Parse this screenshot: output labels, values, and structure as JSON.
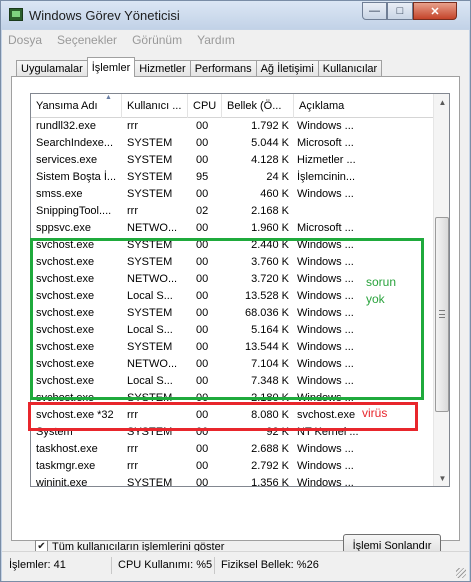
{
  "window": {
    "title": "Windows Görev Yöneticisi",
    "controls": {
      "minimize": "—",
      "maximize": "□",
      "close": "✕"
    }
  },
  "menu": [
    "Dosya",
    "Seçenekler",
    "Görünüm",
    "Yardım"
  ],
  "tabs": [
    "Uygulamalar",
    "İşlemler",
    "Hizmetler",
    "Performans",
    "Ağ İletişimi",
    "Kullanıcılar"
  ],
  "active_tab": "İşlemler",
  "table": {
    "columns": [
      "Yansıma Adı",
      "Kullanıcı ...",
      "CPU",
      "Bellek (Ö...",
      "Açıklama"
    ],
    "rows": [
      [
        "rundll32.exe",
        "rrr",
        "00",
        "1.792 K",
        "Windows ..."
      ],
      [
        "SearchIndexe...",
        "SYSTEM",
        "00",
        "5.044 K",
        "Microsoft ..."
      ],
      [
        "services.exe",
        "SYSTEM",
        "00",
        "4.128 K",
        "Hizmetler ..."
      ],
      [
        "Sistem Boşta İ...",
        "SYSTEM",
        "95",
        "24 K",
        "İşlemcinin..."
      ],
      [
        "smss.exe",
        "SYSTEM",
        "00",
        "460 K",
        "Windows ..."
      ],
      [
        "SnippingTool....",
        "rrr",
        "02",
        "2.168 K",
        ""
      ],
      [
        "sppsvc.exe",
        "NETWO...",
        "00",
        "1.960 K",
        "Microsoft ..."
      ],
      [
        "svchost.exe",
        "SYSTEM",
        "00",
        "2.440 K",
        "Windows ..."
      ],
      [
        "svchost.exe",
        "SYSTEM",
        "00",
        "3.760 K",
        "Windows ..."
      ],
      [
        "svchost.exe",
        "NETWO...",
        "00",
        "3.720 K",
        "Windows ..."
      ],
      [
        "svchost.exe",
        "Local S...",
        "00",
        "13.528 K",
        "Windows ..."
      ],
      [
        "svchost.exe",
        "SYSTEM",
        "00",
        "68.036 K",
        "Windows ..."
      ],
      [
        "svchost.exe",
        "Local S...",
        "00",
        "5.164 K",
        "Windows ..."
      ],
      [
        "svchost.exe",
        "SYSTEM",
        "00",
        "13.544 K",
        "Windows ..."
      ],
      [
        "svchost.exe",
        "NETWO...",
        "00",
        "7.104 K",
        "Windows ..."
      ],
      [
        "svchost.exe",
        "Local S...",
        "00",
        "7.348 K",
        "Windows ..."
      ],
      [
        "svchost.exe",
        "SYSTEM",
        "00",
        "2.180 K",
        "Windows ..."
      ],
      [
        "svchost.exe *32",
        "rrr",
        "00",
        "8.080 K",
        "svchost.exe"
      ],
      [
        "System",
        "SYSTEM",
        "00",
        "92 K",
        "NT Kernel ..."
      ],
      [
        "taskhost.exe",
        "rrr",
        "00",
        "2.688 K",
        "Windows ..."
      ],
      [
        "taskmgr.exe",
        "rrr",
        "00",
        "2.792 K",
        "Windows ..."
      ],
      [
        "wininit.exe",
        "SYSTEM",
        "00",
        "1.356 K",
        "Windows ..."
      ]
    ]
  },
  "annotations": {
    "green_note": [
      "sorun",
      "yok"
    ],
    "red_note": "virüs",
    "green_color": "#1faa3c",
    "red_color": "#e8262c"
  },
  "options": {
    "show_all_users": "Tüm kullanıcıların işlemlerini göster",
    "checked": true,
    "end_process": "İşlemi Sonlandır"
  },
  "status": {
    "processes": "İşlemler: 41",
    "cpu": "CPU Kullanımı: %5",
    "memory": "Fiziksel Bellek: %26"
  }
}
